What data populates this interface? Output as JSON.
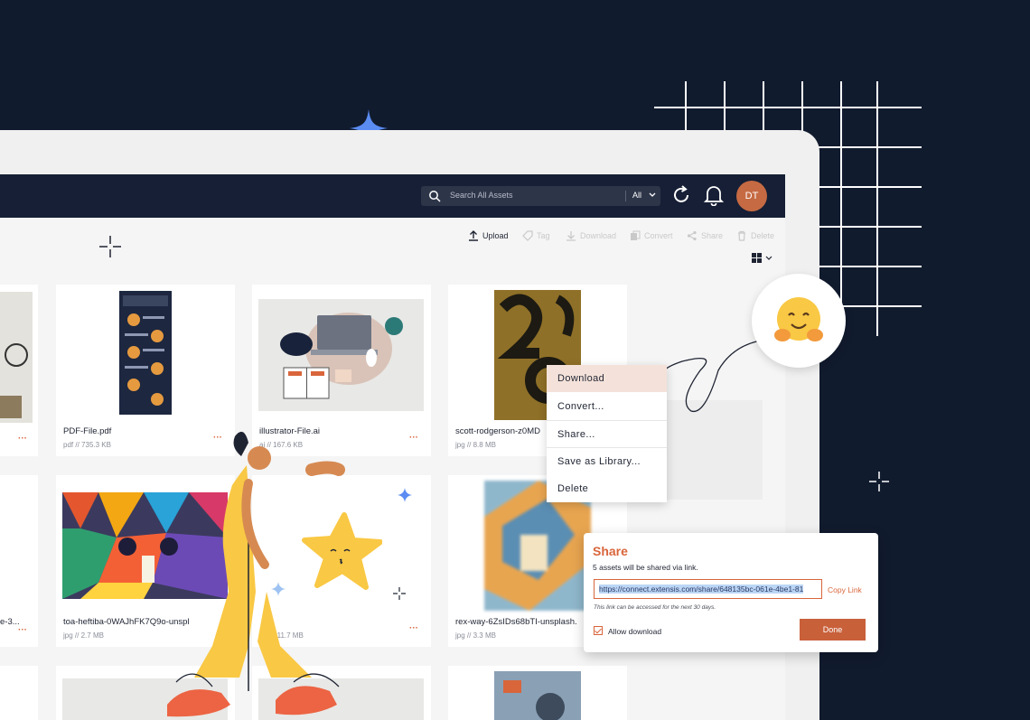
{
  "header": {
    "search_placeholder": "Search All Assets",
    "search_scope": "All",
    "avatar_initials": "DT"
  },
  "toolbar": {
    "upload": "Upload",
    "tag": "Tag",
    "download": "Download",
    "convert": "Convert",
    "share": "Share",
    "delete": "Delete"
  },
  "assets": [
    {
      "name": "PDF-File.pdf",
      "type": "pdf",
      "size": "735.3 KB"
    },
    {
      "name": "illustrator-File.ai",
      "type": "ai",
      "size": "167.6 KB"
    },
    {
      "name": "scott-rodgerson-z0MD",
      "type": "jpg",
      "size": "8.8 MB"
    },
    {
      "name": "toa-heftiba-0WAJhFK7Q9o-unspl",
      "type": "jpg",
      "size": "2.7 MB"
    },
    {
      "name": "",
      "type": "jpg",
      "size": "11.7 MB"
    },
    {
      "name": "rex-way-6ZsIDs68bTI-unsplash.",
      "type": "jpg",
      "size": "3.3 MB"
    },
    {
      "name": "e-3..."
    }
  ],
  "meta_separator": "//",
  "more_dots": "···",
  "context_menu": {
    "items": [
      "Download",
      "Convert...",
      "Share...",
      "Save as Library...",
      "Delete"
    ]
  },
  "share_dialog": {
    "title": "Share",
    "subtitle": "5 assets will be shared via link.",
    "link": "https://connect.extensis.com/share/648135bc-061e-4be1-81",
    "copy_link": "Copy Link",
    "note": "This link can be accessed for the next 30 days.",
    "allow_download": "Allow download",
    "done": "Done"
  },
  "colors": {
    "background": "#111b2e",
    "accent": "#d9653b",
    "header": "#161f35"
  }
}
